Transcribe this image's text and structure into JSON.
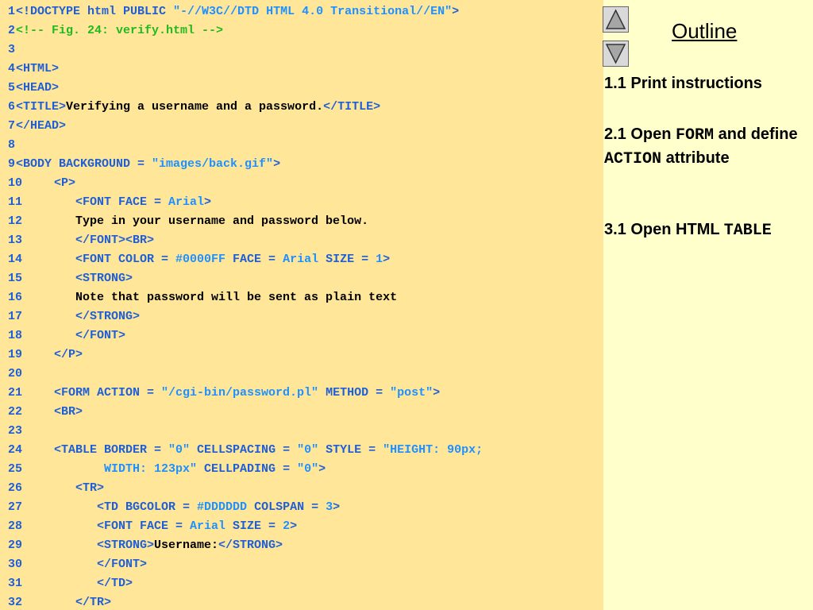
{
  "code": {
    "lines": [
      {
        "n": "1",
        "parts": [
          {
            "c": "t",
            "s": "<!DOCTYPE html PUBLIC "
          },
          {
            "c": "v",
            "s": "\"-//W3C//DTD HTML 4.0 Transitional//EN\""
          },
          {
            "c": "t",
            "s": ">"
          }
        ]
      },
      {
        "n": "2",
        "parts": [
          {
            "c": "c",
            "s": "<!-- Fig. 24: verify.html -->"
          }
        ]
      },
      {
        "n": "3",
        "parts": []
      },
      {
        "n": "4",
        "parts": [
          {
            "c": "t",
            "s": "<HTML>"
          }
        ]
      },
      {
        "n": "5",
        "parts": [
          {
            "c": "t",
            "s": "<HEAD>"
          }
        ]
      },
      {
        "n": "6",
        "parts": [
          {
            "c": "t",
            "s": "<TITLE>"
          },
          {
            "c": "x",
            "s": "Verifying a username and a password."
          },
          {
            "c": "t",
            "s": "</TITLE>"
          }
        ]
      },
      {
        "n": "7",
        "parts": [
          {
            "c": "t",
            "s": "</HEAD>"
          }
        ]
      },
      {
        "n": "8",
        "parts": []
      },
      {
        "n": "9",
        "parts": [
          {
            "c": "t",
            "s": "<BODY BACKGROUND = "
          },
          {
            "c": "v",
            "s": "\"images/back.gif\""
          },
          {
            "c": "t",
            "s": ">"
          }
        ]
      },
      {
        "n": "10",
        "parts": [
          {
            "c": "t",
            "s": "  <P>"
          }
        ]
      },
      {
        "n": "11",
        "parts": [
          {
            "c": "t",
            "s": "     <FONT FACE = "
          },
          {
            "c": "v",
            "s": "Arial"
          },
          {
            "c": "t",
            "s": ">"
          }
        ]
      },
      {
        "n": "12",
        "parts": [
          {
            "c": "x",
            "s": "     Type in your username and password below."
          }
        ]
      },
      {
        "n": "13",
        "parts": [
          {
            "c": "t",
            "s": "     </FONT><BR>"
          }
        ]
      },
      {
        "n": "14",
        "parts": [
          {
            "c": "t",
            "s": "     <FONT COLOR = "
          },
          {
            "c": "v",
            "s": "#0000FF"
          },
          {
            "c": "t",
            "s": " FACE = "
          },
          {
            "c": "v",
            "s": "Arial"
          },
          {
            "c": "t",
            "s": " SIZE = "
          },
          {
            "c": "v",
            "s": "1"
          },
          {
            "c": "t",
            "s": ">"
          }
        ]
      },
      {
        "n": "15",
        "parts": [
          {
            "c": "t",
            "s": "     <STRONG>"
          }
        ]
      },
      {
        "n": "16",
        "parts": [
          {
            "c": "x",
            "s": "     Note that password will be sent as plain text"
          }
        ]
      },
      {
        "n": "17",
        "parts": [
          {
            "c": "t",
            "s": "     </STRONG>"
          }
        ]
      },
      {
        "n": "18",
        "parts": [
          {
            "c": "t",
            "s": "     </FONT>"
          }
        ]
      },
      {
        "n": "19",
        "parts": [
          {
            "c": "t",
            "s": "  </P>"
          }
        ]
      },
      {
        "n": "20",
        "parts": []
      },
      {
        "n": "21",
        "parts": [
          {
            "c": "t",
            "s": "  <FORM ACTION = "
          },
          {
            "c": "v",
            "s": "\"/cgi-bin/password.pl\""
          },
          {
            "c": "t",
            "s": " METHOD = "
          },
          {
            "c": "v",
            "s": "\"post\""
          },
          {
            "c": "t",
            "s": ">"
          }
        ]
      },
      {
        "n": "22",
        "parts": [
          {
            "c": "t",
            "s": "  <BR>"
          }
        ]
      },
      {
        "n": "23",
        "parts": []
      },
      {
        "n": "24",
        "parts": [
          {
            "c": "t",
            "s": "  <TABLE BORDER = "
          },
          {
            "c": "v",
            "s": "\"0\""
          },
          {
            "c": "t",
            "s": " CELLSPACING = "
          },
          {
            "c": "v",
            "s": "\"0\""
          },
          {
            "c": "t",
            "s": " STYLE = "
          },
          {
            "c": "v",
            "s": "\"HEIGHT: 90px;"
          }
        ]
      },
      {
        "n": "25",
        "parts": [
          {
            "c": "v",
            "s": "         WIDTH: 123px\""
          },
          {
            "c": "t",
            "s": " CELLPADING = "
          },
          {
            "c": "v",
            "s": "\"0\""
          },
          {
            "c": "t",
            "s": ">"
          }
        ]
      },
      {
        "n": "26",
        "parts": [
          {
            "c": "t",
            "s": "     <TR>"
          }
        ]
      },
      {
        "n": "27",
        "parts": [
          {
            "c": "t",
            "s": "        <TD BGCOLOR = "
          },
          {
            "c": "v",
            "s": "#DDDDDD"
          },
          {
            "c": "t",
            "s": " COLSPAN = "
          },
          {
            "c": "v",
            "s": "3"
          },
          {
            "c": "t",
            "s": ">"
          }
        ]
      },
      {
        "n": "28",
        "parts": [
          {
            "c": "t",
            "s": "        <FONT FACE = "
          },
          {
            "c": "v",
            "s": "Arial"
          },
          {
            "c": "t",
            "s": " SIZE = "
          },
          {
            "c": "v",
            "s": "2"
          },
          {
            "c": "t",
            "s": ">"
          }
        ]
      },
      {
        "n": "29",
        "parts": [
          {
            "c": "t",
            "s": "        <STRONG>"
          },
          {
            "c": "x",
            "s": "Username:"
          },
          {
            "c": "t",
            "s": "</STRONG>"
          }
        ]
      },
      {
        "n": "30",
        "parts": [
          {
            "c": "t",
            "s": "        </FONT>"
          }
        ]
      },
      {
        "n": "31",
        "parts": [
          {
            "c": "t",
            "s": "        </TD>"
          }
        ]
      },
      {
        "n": "32",
        "parts": [
          {
            "c": "t",
            "s": "     </TR>"
          }
        ]
      }
    ]
  },
  "nav": {
    "up_icon": "triangle-up-icon",
    "down_icon": "triangle-down-icon"
  },
  "outline": {
    "title": "Outline",
    "item1": "1.1 Print instructions",
    "item2_a": "2.1 Open ",
    "item2_code1": "FORM",
    "item2_b": " and define ",
    "item2_code2": "ACTION",
    "item2_c": " attribute",
    "item3_a": "3.1 Open HTML ",
    "item3_code": "TABLE"
  },
  "colors": {
    "code_bg": "#FFE699",
    "panel_bg": "#FFFFCC",
    "tag": "#1F5FD6",
    "value": "#1E90FF",
    "comment": "#22B822",
    "text": "#000000"
  }
}
